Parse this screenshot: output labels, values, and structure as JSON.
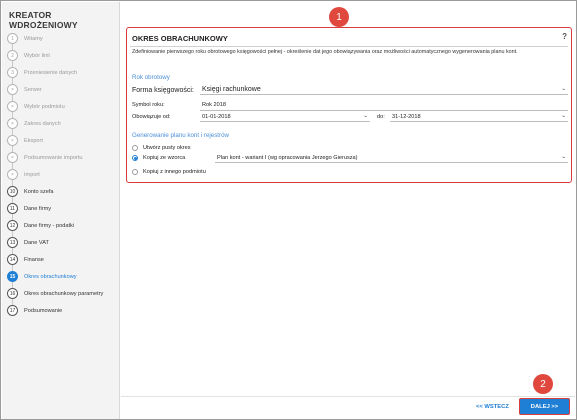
{
  "app_title": "KREATOR WDROŻENIOWY",
  "steps": [
    {
      "num": "1",
      "label": "Witamy",
      "state": "disabled"
    },
    {
      "num": "2",
      "label": "Wybór linii",
      "state": "disabled"
    },
    {
      "num": "3",
      "label": "Przeniesienie danych",
      "state": "disabled"
    },
    {
      "num": "×",
      "label": "Serwer",
      "state": "disabled"
    },
    {
      "num": "×",
      "label": "Wybór podmiotu",
      "state": "disabled"
    },
    {
      "num": "×",
      "label": "Zakres danych",
      "state": "disabled"
    },
    {
      "num": "×",
      "label": "Eksport",
      "state": "disabled"
    },
    {
      "num": "×",
      "label": "Podsumowanie importu",
      "state": "disabled"
    },
    {
      "num": "×",
      "label": "Import",
      "state": "disabled"
    },
    {
      "num": "10",
      "label": "Konto szefa",
      "state": "active"
    },
    {
      "num": "11",
      "label": "Dane firmy",
      "state": "active"
    },
    {
      "num": "12",
      "label": "Dane firmy - podatki",
      "state": "active"
    },
    {
      "num": "13",
      "label": "Dane VAT",
      "state": "active"
    },
    {
      "num": "14",
      "label": "Finanse",
      "state": "active"
    },
    {
      "num": "15",
      "label": "Okres obrachunkowy",
      "state": "current"
    },
    {
      "num": "16",
      "label": "Okres obrachunkowy parametry",
      "state": "active"
    },
    {
      "num": "17",
      "label": "Podsumowanie",
      "state": "active"
    }
  ],
  "panel": {
    "title": "OKRES OBRACHUNKOWY",
    "help": "?",
    "description": "Zdefiniowanie pierwszego roku obrotowego księgowości pełnej - określenie dat jego obowiązywania oraz możliwości automatycznego wygenerowania planu kont.",
    "rok_obrotowy": {
      "heading": "Rok obrotowy",
      "forma_label": "Forma księgowości:",
      "forma_value": "Księgi rachunkowe",
      "symbol_label": "Symbol roku:",
      "symbol_value": "Rok 2018",
      "obowiazuje_label": "Obowiązuje od:",
      "od_value": "01-01-2018",
      "do_label": "do:",
      "do_value": "31-12-2018"
    },
    "generowanie": {
      "heading": "Generowanie planu kont i rejestrów",
      "option1": "Utwórz pusty okres",
      "option2": "Kopiuj ze wzorca",
      "option2_value": "Plan kont - wariant I (wg opracowania Jerzego Gierusza)",
      "option3": "Kopiuj z innego podmiotu"
    }
  },
  "badges": {
    "one": "1",
    "two": "2"
  },
  "footer": {
    "back": "<< WSTECZ",
    "next": "DALEJ >>"
  },
  "colors": {
    "accent": "#1f7fd4",
    "highlight": "#d93c3c",
    "badge": "#e0483e"
  }
}
